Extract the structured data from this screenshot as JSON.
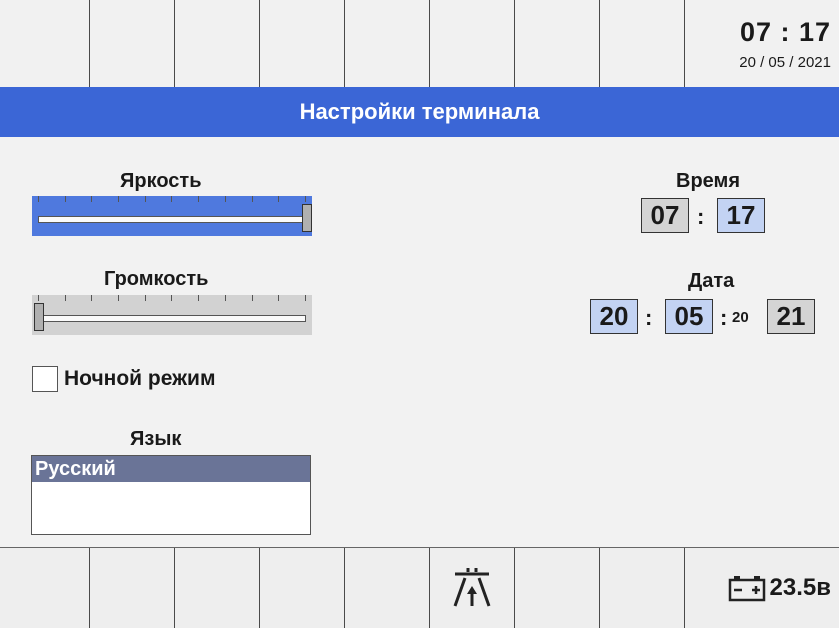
{
  "header": {
    "time": "07 : 17",
    "date": "20 / 05 / 2021"
  },
  "title": "Настройки терминала",
  "brightness": {
    "label": "Яркость",
    "level_percent": 100
  },
  "volume": {
    "label": "Громкость",
    "level_percent": 0
  },
  "night_mode": {
    "label": "Ночной режим",
    "checked": false
  },
  "language": {
    "label": "Язык",
    "selected": "Русский"
  },
  "time_setting": {
    "label": "Время",
    "hours": "07",
    "separator": ":",
    "minutes": "17"
  },
  "date_setting": {
    "label": "Дата",
    "day": "20",
    "month": "05",
    "separator": ":",
    "year_prefix": "20",
    "year_suffix": "21"
  },
  "footer": {
    "battery_voltage": "23.5в",
    "icons": [
      "road-lane-icon",
      "battery-icon"
    ]
  },
  "colors": {
    "title_bar": "#3b66d6",
    "active_slider": "#4f79de",
    "selected_item": "#6a7497",
    "active_field": "#c3d3f3"
  }
}
